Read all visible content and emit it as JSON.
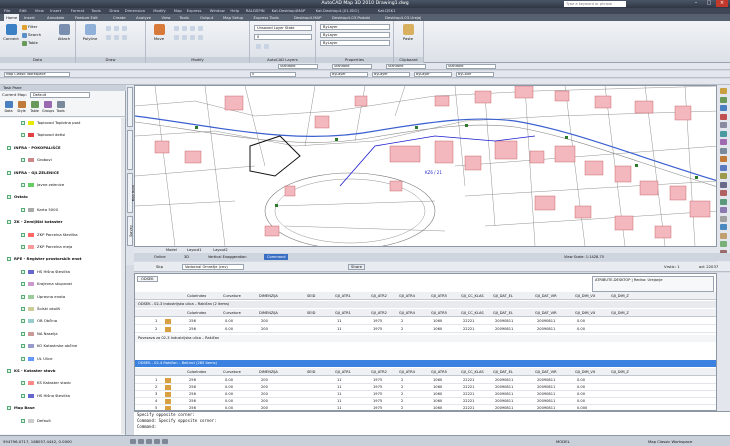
{
  "window": {
    "title": "AutoCAD Map 3D 2010    Drawing1.dwg",
    "search_placeholder": "Type a keyword or phrase",
    "minimize": "–",
    "maximize": "□",
    "close": "×"
  },
  "quick_access": [
    "File",
    "Edit",
    "View",
    "Insert",
    "Format",
    "Tools",
    "Draw",
    "Dimension",
    "Modify",
    "Map",
    "Express",
    "Window",
    "Help",
    "RALDSPIN",
    "Kat.Desktop4MAP",
    "Kat.Desktop4.(01.ISIO)",
    "Kat.DSK1"
  ],
  "ribbon_tabs": [
    {
      "label": "Home",
      "active": true
    },
    {
      "label": "Insert"
    },
    {
      "label": "Annotate"
    },
    {
      "label": "Feature Edit"
    },
    {
      "label": "Create"
    },
    {
      "label": "Analyze"
    },
    {
      "label": "View"
    },
    {
      "label": "Tools"
    },
    {
      "label": "Output"
    },
    {
      "label": "Map Setup"
    },
    {
      "label": "Express Tools"
    },
    {
      "label": "Desktop4.MAP"
    },
    {
      "label": "Desktop4.03.Podobi"
    },
    {
      "label": "Desktop4.03.Urejaj"
    }
  ],
  "ribbon": {
    "data": {
      "label": "Data",
      "connect": "Connect",
      "filter": "Filter",
      "search": "Search",
      "table": "Table",
      "attach": "Attach"
    },
    "draw": {
      "label": "Draw",
      "polyline": "Polyline"
    },
    "modify": {
      "label": "Modify",
      "move": "Move"
    },
    "layers": {
      "label": "AutoCAD Layers",
      "unsaved_state": "Unsaved Layer State",
      "current": "0"
    },
    "properties": {
      "label": "Properties",
      "bylayer1": "ByLayer",
      "bylayer2": "ByLayer",
      "bylayer3": "ByLayer"
    },
    "clipboard": {
      "label": "Clipboard",
      "paste": "Paste"
    }
  },
  "toolbar2": {
    "standard1": "Standard",
    "standard2": "Standard",
    "standard3": "Standard",
    "standard4": "Standard"
  },
  "toolbar3": {
    "workspace": "Map Classic Workspace",
    "layer": "0",
    "bylayer1": "ByLayer",
    "bylayer2": "ByLayer",
    "bylayer3": "ByLayer",
    "bycolor": "ByColor"
  },
  "taskpane": {
    "title": "Task Pane",
    "current_map_label": "Current Map:",
    "current_map_value": "Default",
    "tools": [
      "Data",
      "Style",
      "Table",
      "Groups",
      "Tools"
    ],
    "layers": [
      {
        "name": "Toplovod Toplotna post",
        "indent": 18,
        "type": "item",
        "color": "#e8e800"
      },
      {
        "name": "Toplovod detisi",
        "indent": 18,
        "type": "item",
        "color": "#e04040"
      },
      {
        "name": "INFRA - POKOPALIŠČE",
        "indent": 4,
        "type": "group"
      },
      {
        "name": "Grobovi",
        "indent": 18,
        "type": "item",
        "color": "#c88"
      },
      {
        "name": "INFRA - GJI.ZELENICE",
        "indent": 4,
        "type": "group"
      },
      {
        "name": "Javne zelenice",
        "indent": 18,
        "type": "item",
        "color": "#6c6"
      },
      {
        "name": "Ostalo",
        "indent": 4,
        "type": "group"
      },
      {
        "name": "Karta 5000",
        "indent": 18,
        "type": "item",
        "color": "#aaa"
      },
      {
        "name": "ZK - Zemljiški kataster",
        "indent": 4,
        "type": "group"
      },
      {
        "name": "ZKP Parcelna številka",
        "indent": 18,
        "type": "item",
        "color": "#f66"
      },
      {
        "name": "ZKP Parcelna meja",
        "indent": 18,
        "type": "item",
        "color": "#f99"
      },
      {
        "name": "RPE - Register prostorskih enot",
        "indent": 4,
        "type": "group"
      },
      {
        "name": "HS Hišna številka",
        "indent": 18,
        "type": "item",
        "color": "#66c"
      },
      {
        "name": "Krajevna skupnost",
        "indent": 18,
        "type": "item",
        "color": "#c9c"
      },
      {
        "name": "Upravna enota",
        "indent": 18,
        "type": "item",
        "color": "#9c9"
      },
      {
        "name": "Šolski okoliš",
        "indent": 18,
        "type": "item",
        "color": "#cc9"
      },
      {
        "name": "OB Občina",
        "indent": 18,
        "type": "item",
        "color": "#9cc"
      },
      {
        "name": "NA Naselja",
        "indent": 18,
        "type": "item",
        "color": "#c99"
      },
      {
        "name": "KO Katastrske občine",
        "indent": 18,
        "type": "item",
        "color": "#99c"
      },
      {
        "name": "UL Ulice",
        "indent": 18,
        "type": "item",
        "color": "#69f"
      },
      {
        "name": "KS - Kataster stavb",
        "indent": 4,
        "type": "group"
      },
      {
        "name": "KS Kataster stavb",
        "indent": 18,
        "type": "item",
        "color": "#f88"
      },
      {
        "name": "HS Hišna številka",
        "indent": 18,
        "type": "item",
        "color": "#66c"
      },
      {
        "name": "Map Base",
        "indent": 4,
        "type": "group"
      },
      {
        "name": "Default",
        "indent": 18,
        "type": "item",
        "color": "#ccc"
      }
    ]
  },
  "side_tabs": [
    "Display Manager",
    "Map Explorer",
    "Map Book",
    "Survey"
  ],
  "drawing": {
    "labels": [
      "KZ6 / 21"
    ]
  },
  "layout_tabs": [
    "Model",
    "Layout1",
    "Layout2"
  ],
  "command_tabs": [
    "Online",
    "3D",
    "Vertical Exaggeration",
    "Command"
  ],
  "view_scale": "View Scale: 1:1428.75",
  "data_table": {
    "bar_label": "Skp",
    "dropdown": "Vodocnal Omrežje (cev)",
    "share": "Share",
    "vrstic_label": "Vrstic: 1",
    "count": "od: 22037",
    "tab": "ODSEK",
    "info_line1": "ATRIBUTE-DESKTOP | Redno: Urejanje",
    "columns": [
      "Colorlndex",
      "Curvature",
      "DIMENZIJA",
      "SEID",
      "GJI_ATR1",
      "GJI_ATR2",
      "GJI_ATR4",
      "GJI_ATR5",
      "GJI_CC_KLAS",
      "GJI_DAT_EL",
      "GJI_DAT_VIR",
      "GJI_DIM_VX",
      "GJI_DIM_Z"
    ],
    "group1": "ODSEK - 02-3 Industrijska ulica – Rakičan (2 items)",
    "group1_rows": [
      [
        "1",
        "256",
        "0.00",
        "200",
        "",
        "11",
        "1975",
        "2",
        "1060",
        "22221",
        "20090811",
        "20090811",
        "0.00"
      ],
      [
        "2",
        "256",
        "0.00",
        "200",
        "",
        "11",
        "1975",
        "2",
        "1060",
        "22221",
        "20090811",
        "20090811",
        "0.00"
      ]
    ],
    "group1_footer": "Povezava za 02-3 Industrijska ulica – Rakičan",
    "group2": "ODSEK - 02-4 Rakičan – Beltinci (285 items)",
    "group2_rows": [
      [
        "1",
        "256",
        "0.00",
        "200",
        "",
        "11",
        "1975",
        "2",
        "1060",
        "22221",
        "20090811",
        "20090811",
        "0.00"
      ],
      [
        "2",
        "256",
        "0.00",
        "200",
        "",
        "11",
        "1975",
        "2",
        "1060",
        "22221",
        "20090811",
        "20090811",
        "0.00"
      ],
      [
        "3",
        "256",
        "0.00",
        "200",
        "",
        "11",
        "1975",
        "2",
        "1060",
        "22221",
        "20090811",
        "20090811",
        "0.00"
      ],
      [
        "4",
        "256",
        "0.00",
        "200",
        "",
        "11",
        "1975",
        "2",
        "1060",
        "22221",
        "20090811",
        "20090811",
        "0.00"
      ],
      [
        "5",
        "256",
        "0.00",
        "200",
        "",
        "11",
        "1975",
        "2",
        "1060",
        "22221",
        "20090811",
        "20090811",
        "0.000"
      ]
    ]
  },
  "command_line": [
    "Specify opposite corner:",
    "Command: Specify opposite corner:",
    "Command:"
  ],
  "status": {
    "coords": "594796.0717, 168057.4442, 0.0000",
    "model": "MODEL",
    "workspace": "Map Classic Workspace"
  }
}
